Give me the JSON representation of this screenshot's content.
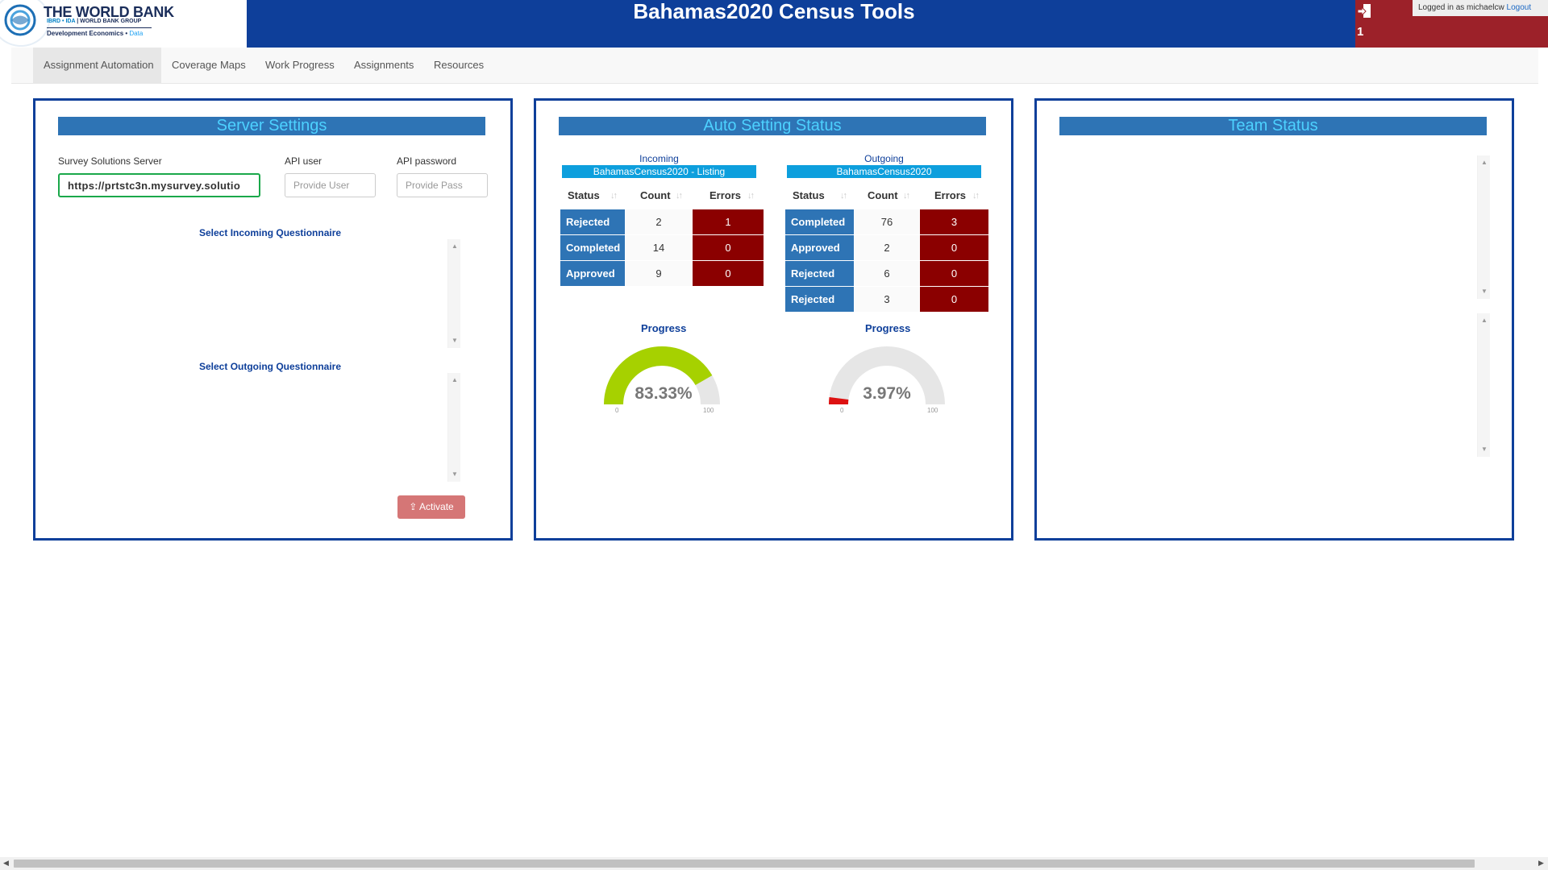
{
  "header": {
    "title": "Bahamas2020 Census Tools",
    "logo": {
      "line1": "THE WORLD BANK",
      "line2_a": "IBRD • IDA",
      "line2_b": "WORLD BANK GROUP",
      "line3_a": "Development Economics •",
      "line3_b": "Data"
    },
    "notification_count": "1",
    "logged_in_text": "Logged in as michaelcw",
    "logout_label": "Logout"
  },
  "nav": {
    "tabs": [
      {
        "label": "Assignment Automation",
        "active": true
      },
      {
        "label": "Coverage Maps"
      },
      {
        "label": "Work Progress"
      },
      {
        "label": "Assignments"
      },
      {
        "label": "Resources"
      }
    ]
  },
  "server_settings": {
    "title": "Server Settings",
    "server_label": "Survey Solutions Server",
    "server_value": "https://prtstc3n.mysurvey.solutio",
    "api_user_label": "API user",
    "api_user_placeholder": "Provide User",
    "api_password_label": "API password",
    "api_password_placeholder": "Provide Pass",
    "incoming_label": "Select Incoming Questionnaire",
    "outgoing_label": "Select Outgoing Questionnaire",
    "activate_label": "Activate"
  },
  "auto_status": {
    "title": "Auto Setting Status",
    "columns": [
      "Status",
      "Count",
      "Errors"
    ],
    "incoming": {
      "direction": "Incoming",
      "questionnaire": "BahamasCensus2020 - Listing",
      "rows": [
        {
          "status": "Rejected",
          "count": "2",
          "errors": "1"
        },
        {
          "status": "Completed",
          "count": "14",
          "errors": "0"
        },
        {
          "status": "Approved",
          "count": "9",
          "errors": "0"
        }
      ],
      "progress_label": "Progress",
      "progress_value": 83.33,
      "progress_text": "83.33%",
      "gauge_min": "0",
      "gauge_max": "100",
      "gauge_color": "#a6d100"
    },
    "outgoing": {
      "direction": "Outgoing",
      "questionnaire": "BahamasCensus2020",
      "rows": [
        {
          "status": "Completed",
          "count": "76",
          "errors": "3"
        },
        {
          "status": "Approved",
          "count": "2",
          "errors": "0"
        },
        {
          "status": "Rejected",
          "count": "6",
          "errors": "0"
        },
        {
          "status": "Rejected",
          "count": "3",
          "errors": "0"
        }
      ],
      "progress_label": "Progress",
      "progress_value": 3.97,
      "progress_text": "3.97%",
      "gauge_min": "0",
      "gauge_max": "100",
      "gauge_color": "#dd1111"
    }
  },
  "team_status": {
    "title": "Team Status"
  },
  "colors": {
    "header_bg": "#0e3f9a",
    "user_area_bg": "#9c2129",
    "panel_title_bg": "#2e74b5",
    "panel_title_text": "#4dd1ff",
    "error_cell": "#8b0000"
  }
}
